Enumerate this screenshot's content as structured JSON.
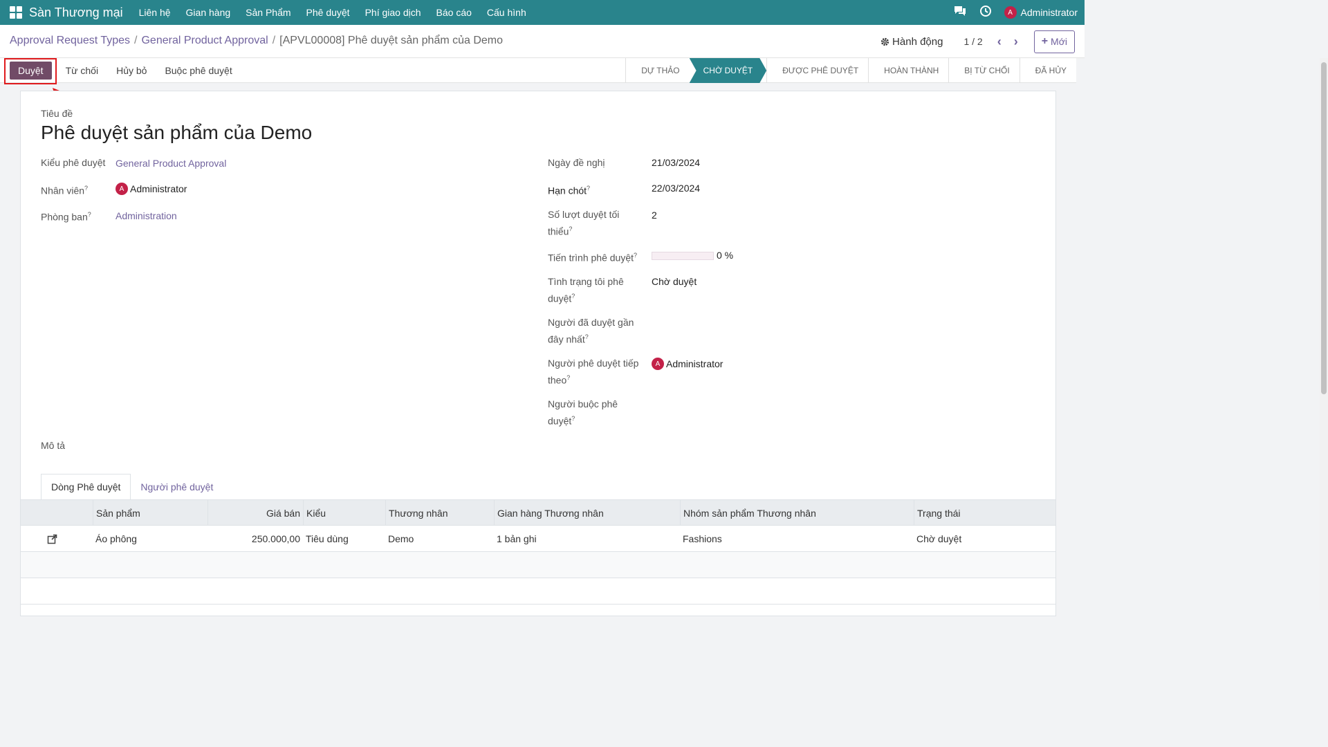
{
  "topnav": {
    "brand": "Sàn Thương mại",
    "menu": [
      "Liên hệ",
      "Gian hàng",
      "Sản Phẩm",
      "Phê duyệt",
      "Phí giao dịch",
      "Báo cáo",
      "Cấu hình"
    ],
    "user_initial": "A",
    "user_name": "Administrator"
  },
  "breadcrumb": {
    "items": [
      "Approval Request Types",
      "General Product Approval"
    ],
    "current": "[APVL00008] Phê duyệt sản phẩm của Demo"
  },
  "control": {
    "action_label": "Hành động",
    "pager": "1 / 2",
    "new_label": "Mới"
  },
  "statusbar": {
    "buttons": [
      "Duyệt",
      "Từ chối",
      "Hủy bỏ",
      "Buộc phê duyệt"
    ],
    "stages": [
      "Dự thảo",
      "Chờ duyệt",
      "Được phê duyệt",
      "Hoàn thành",
      "Bị từ chối",
      "Đã hủy"
    ],
    "active_stage": "Chờ duyệt"
  },
  "form": {
    "title_label": "Tiêu đề",
    "title": "Phê duyệt sản phẩm của Demo",
    "left": {
      "type_label": "Kiểu phê duyệt",
      "type_value": "General Product Approval",
      "employee_label": "Nhân viên",
      "employee_initial": "A",
      "employee_value": "Administrator",
      "department_label": "Phòng ban",
      "department_value": "Administration"
    },
    "right": {
      "request_date_label": "Ngày đề nghị",
      "request_date": "21/03/2024",
      "deadline_label": "Hạn chót",
      "deadline": "22/03/2024",
      "min_approvals_label": "Số lượt duyệt tối thiểu",
      "min_approvals": "2",
      "progress_label": "Tiến trình phê duyệt",
      "progress_text": "0 %",
      "progress_value": 0,
      "my_status_label": "Tình trạng tôi phê duyệt",
      "my_status": "Chờ duyệt",
      "last_approver_label": "Người đã duyệt gần đây nhất",
      "next_approver_label": "Người phê duyệt tiếp theo",
      "next_approver_initial": "A",
      "next_approver": "Administrator",
      "force_approver_label": "Người buộc phê duyệt"
    },
    "description_label": "Mô tả"
  },
  "tabs": [
    "Dòng Phê duyệt",
    "Người phê duyệt"
  ],
  "table": {
    "headers": [
      "Sản phẩm",
      "Giá bán",
      "Kiểu",
      "Thương nhân",
      "Gian hàng Thương nhân",
      "Nhóm sản phẩm Thương nhân",
      "Trạng thái"
    ],
    "rows": [
      [
        "Áo phông",
        "250.000,00",
        "Tiêu dùng",
        "Demo",
        "1 bản ghi",
        "Fashions",
        "Chờ duyệt"
      ]
    ]
  },
  "colors": {
    "topbar": "#29848c",
    "primary": "#714b67",
    "link": "#71639e",
    "highlight": "#e0191c"
  }
}
